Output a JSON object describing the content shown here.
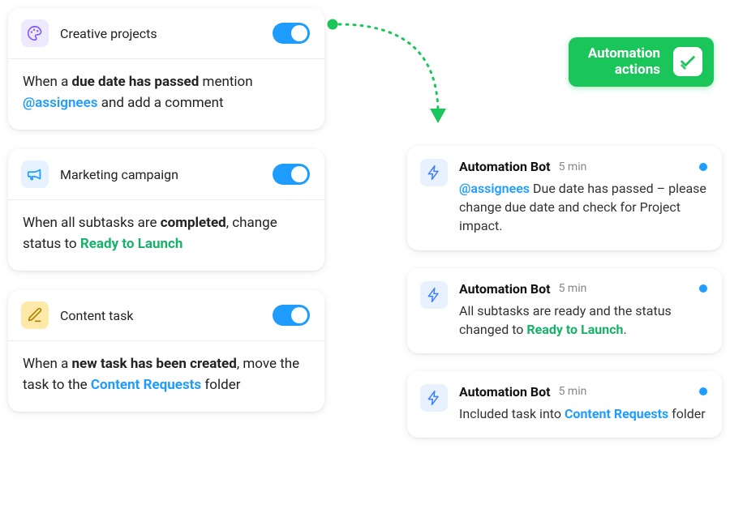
{
  "rules": [
    {
      "title": "Creative projects",
      "iconClass": "icon-purple",
      "iconName": "palette-icon",
      "bodyHtml": "When a <b>due date has passed</b> mention <span class='mention'>@assignees</span> and add a comment"
    },
    {
      "title": "Marketing campaign",
      "iconClass": "icon-blue",
      "iconName": "megaphone-icon",
      "bodyHtml": "When all subtasks are <b>completed</b>, change status to <span class='status-green'>Ready to Launch</span>"
    },
    {
      "title": "Content task",
      "iconClass": "icon-yellow",
      "iconName": "edit-icon",
      "bodyHtml": "When a <b>new task has been created</b>, move the task to the <span class='link-blue'>Content Requests</span> folder"
    }
  ],
  "badge": {
    "line1": "Automation",
    "line2": "actions"
  },
  "bot": {
    "name": "Automation Bot",
    "time": "5 min",
    "messages": [
      "<span class='mention'>@assignees</span> Due date has passed – please change due date and check for Project impact.",
      "All subtasks are ready and the status changed to <span class='status-green'>Ready to Launch</span>.",
      "Included task into <span class='link-blue'>Content Requests</span> folder"
    ]
  }
}
